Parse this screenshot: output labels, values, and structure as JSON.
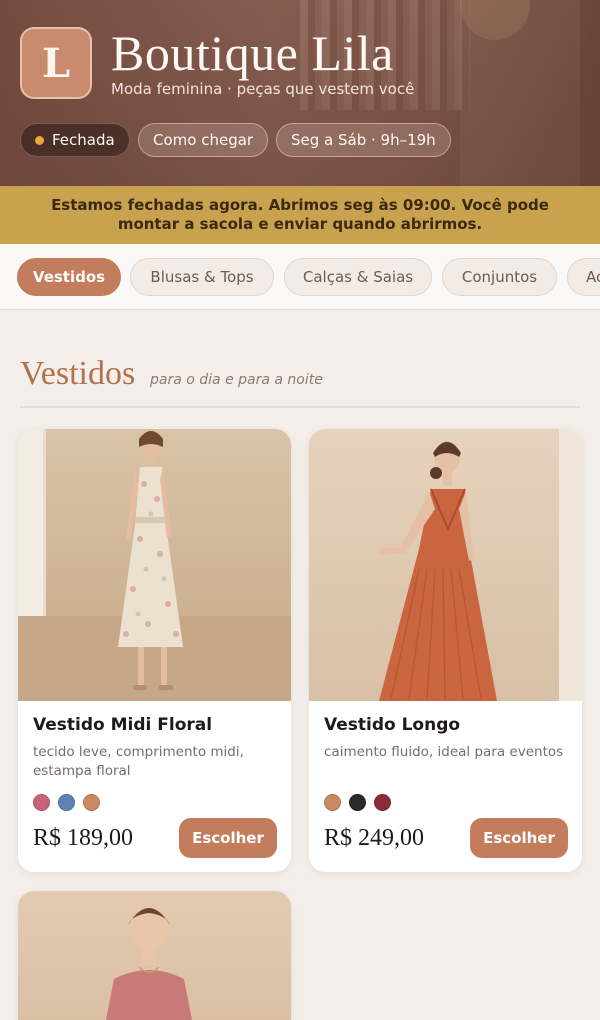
{
  "store": {
    "logo_letter": "L",
    "name": "Boutique Lila",
    "tagline": "Moda feminina · peças que vestem você",
    "status": "Fechada",
    "directions_label": "Como chegar",
    "hours_label": "Seg a Sáb · 9h–19h"
  },
  "notice": {
    "text": "Estamos fechadas agora. Abrimos seg às 09:00. Você pode montar a sacola e enviar quando abrirmos."
  },
  "tabs": [
    {
      "label": "Vestidos",
      "active": true
    },
    {
      "label": "Blusas & Tops",
      "active": false
    },
    {
      "label": "Calças & Saias",
      "active": false
    },
    {
      "label": "Conjuntos",
      "active": false
    },
    {
      "label": "Ac",
      "active": false
    }
  ],
  "section": {
    "title": "Vestidos",
    "subtitle": "para o dia e para a noite"
  },
  "products": [
    {
      "name": "Vestido Midi Floral",
      "description": "tecido leve, comprimento midi, estampa floral",
      "swatches": [
        "#c9637a",
        "#5d83b4",
        "#c98a63"
      ],
      "price": "R$ 189,00",
      "button": "Escolher"
    },
    {
      "name": "Vestido Longo",
      "description": "caimento fluido, ideal para eventos",
      "swatches": [
        "#c98a63",
        "#2a2a2a",
        "#8a2a3a"
      ],
      "price": "R$ 249,00",
      "button": "Escolher"
    }
  ],
  "colors": {
    "accent": "#c47d5c",
    "notice_bg": "#c9a24f",
    "status_dot": "#e7a93a"
  }
}
